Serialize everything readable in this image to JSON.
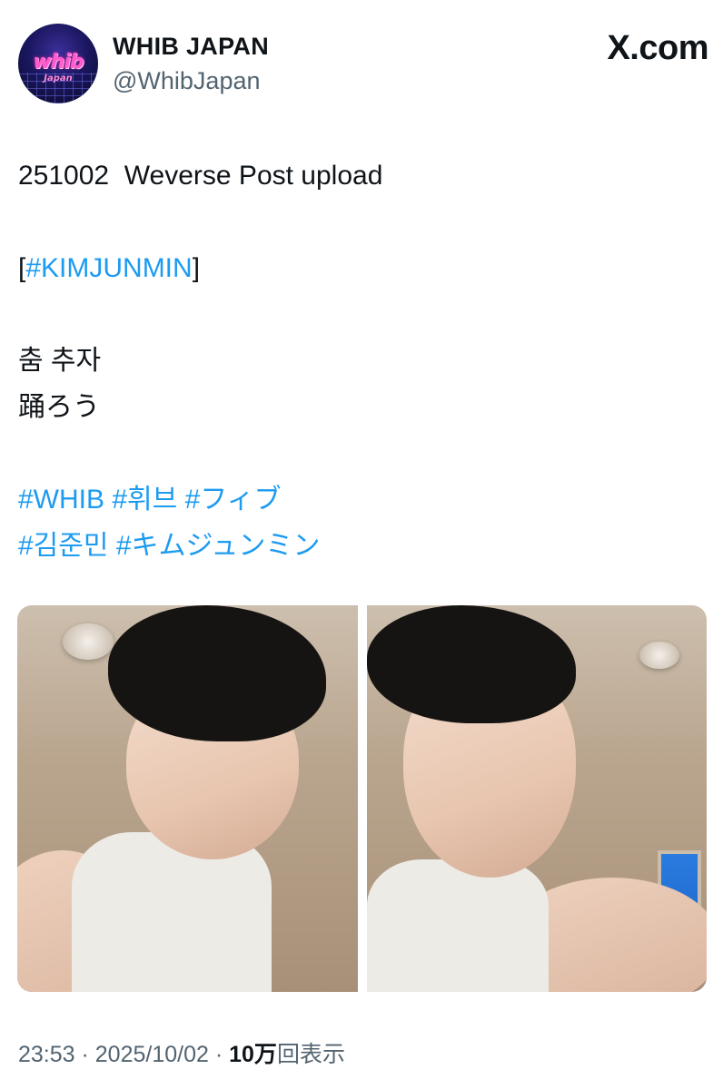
{
  "header": {
    "avatar_logo_main": "whib",
    "avatar_logo_sub": "Japan",
    "display_name": "WHIB JAPAN",
    "handle": "@WhibJapan",
    "site": "X.com"
  },
  "post": {
    "line1": "251002  Weverse Post upload",
    "line2_prefix": "[",
    "line2_tag": "#KIMJUNMIN",
    "line2_suffix": "]",
    "line3": "춤 추자",
    "line4": "踊ろう",
    "tags_row1": [
      "#WHIB",
      "#휘브",
      "#フィブ"
    ],
    "tags_row2": [
      "#김준민",
      "#キムジュンミン"
    ]
  },
  "media": {
    "count": 2
  },
  "footer": {
    "time": "23:53",
    "separator": " · ",
    "date": "2025/10/02",
    "views_count": "10万",
    "views_label": "回表示"
  },
  "colors": {
    "text": "#0f1419",
    "secondary": "#536471",
    "link": "#1d9bf0"
  }
}
